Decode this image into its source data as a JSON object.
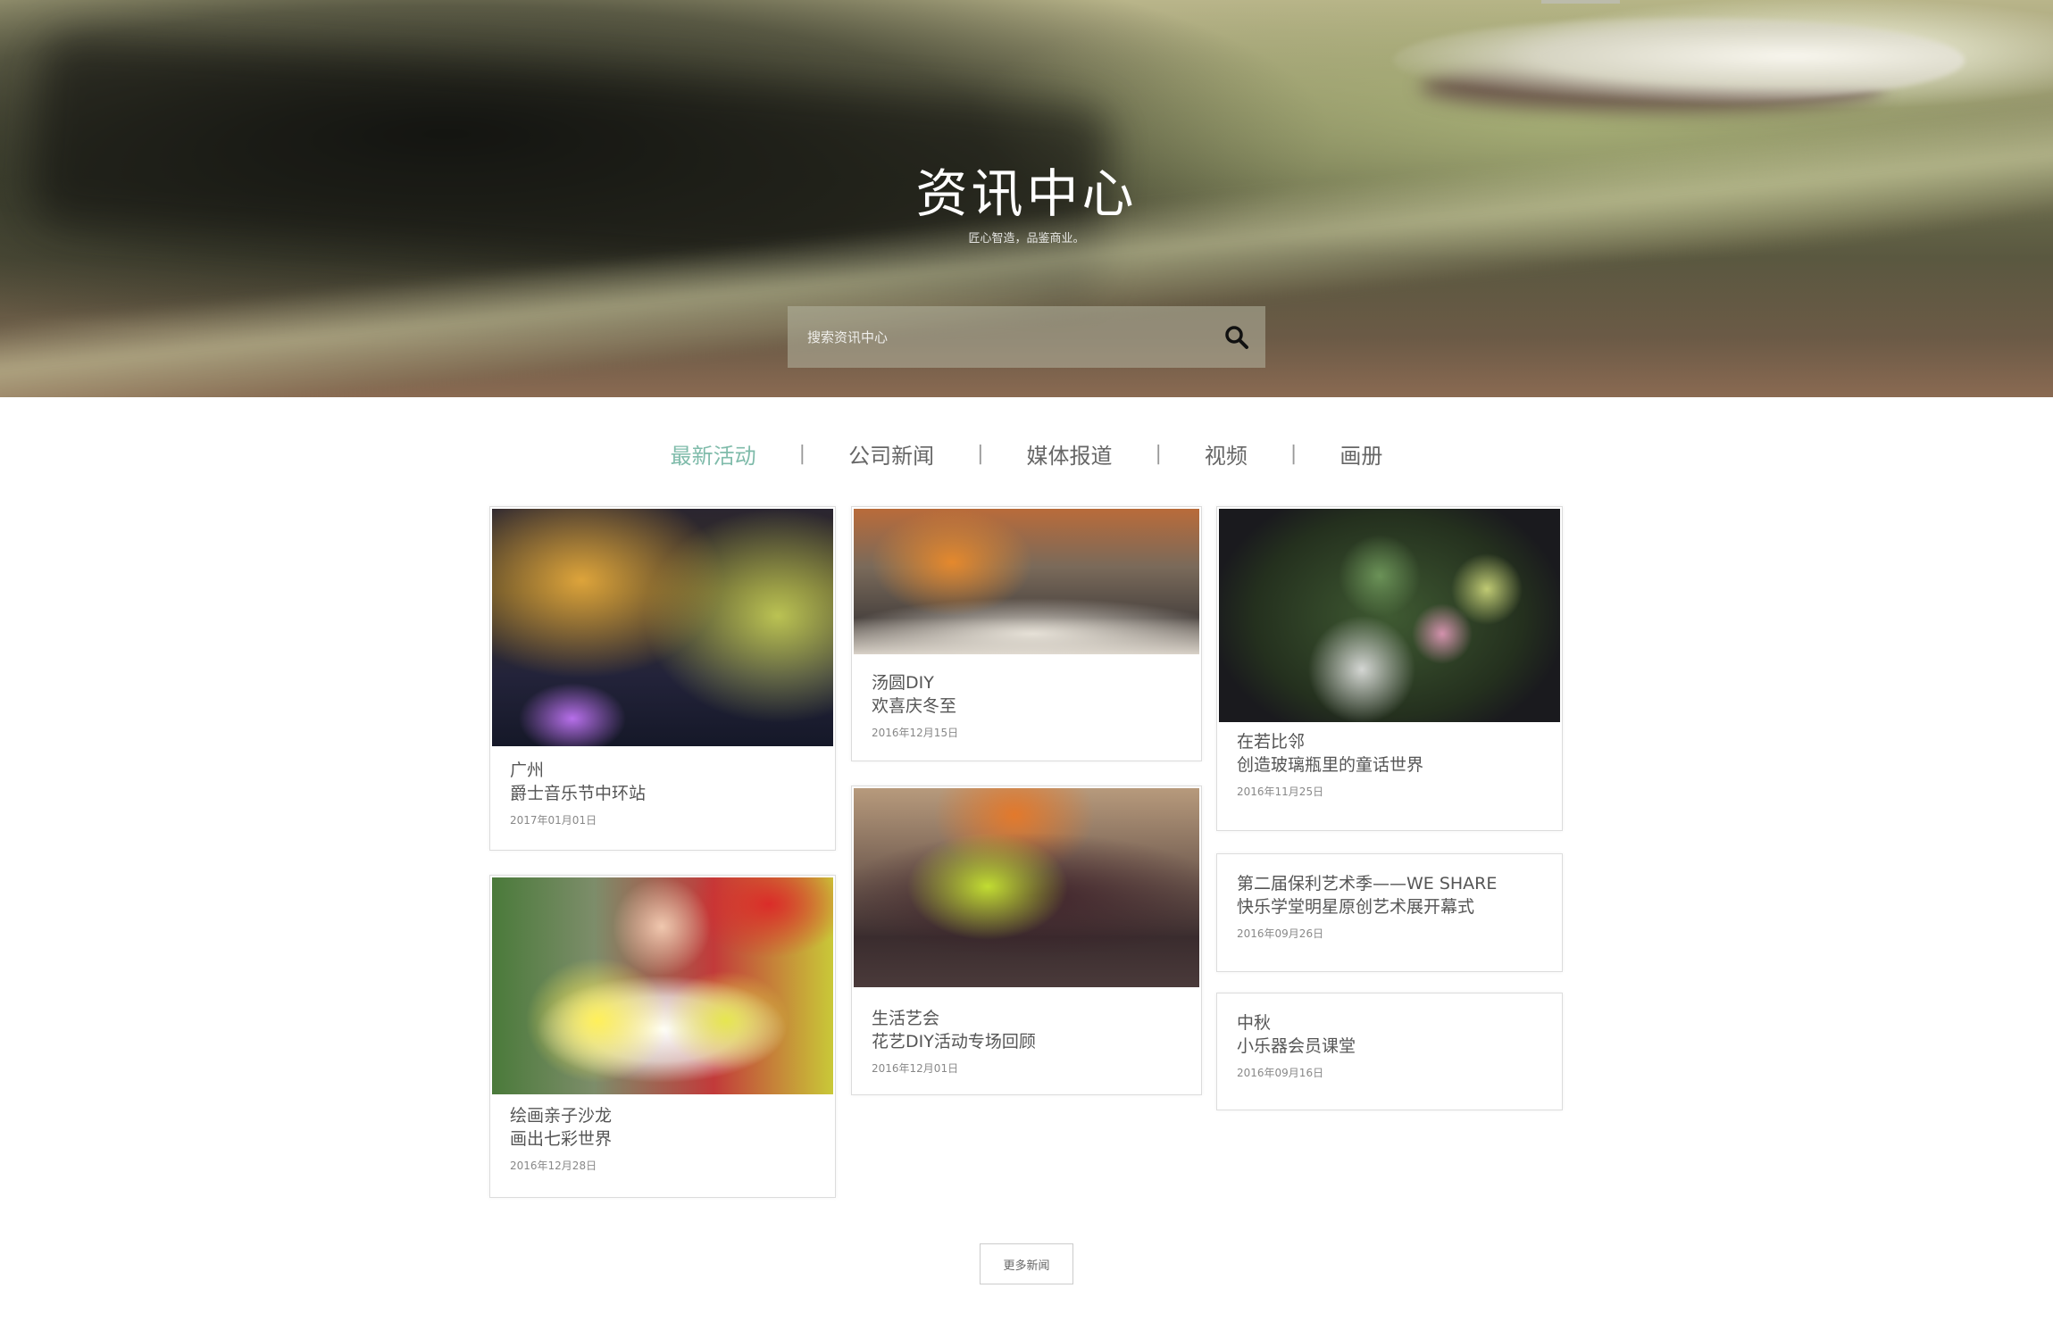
{
  "hero": {
    "title": "资讯中心",
    "subtitle": "匠心智造，品鉴商业。"
  },
  "search": {
    "placeholder": "搜索资讯中心",
    "button_icon": "search-icon"
  },
  "tabs": [
    {
      "label": "最新活动",
      "active": true
    },
    {
      "label": "公司新闻",
      "active": false
    },
    {
      "label": "媒体报道",
      "active": false
    },
    {
      "label": "视频",
      "active": false
    },
    {
      "label": "画册",
      "active": false
    }
  ],
  "tab_separator": "|",
  "colors": {
    "accent": "#7fbbaa",
    "text": "#555555",
    "muted": "#888888",
    "border": "#dcdcdc"
  },
  "cards": [
    {
      "line1": "广州",
      "line2": "爵士音乐节中环站",
      "date": "2017年01月01日",
      "image": "jazz-concert-photo"
    },
    {
      "line1": "汤圆DIY",
      "line2": "欢喜庆冬至",
      "date": "2016年12月15日",
      "image": "dinner-gathering-photo"
    },
    {
      "line1": "在若比邻",
      "line2": "创造玻璃瓶里的童话世界",
      "date": "2016年11月25日",
      "image": "succulent-terrarium-photo"
    },
    {
      "line1": "绘画亲子沙龙",
      "line2": "画出七彩世界",
      "date": "2016年12月28日",
      "image": "child-drawing-photo"
    },
    {
      "line1": "生活艺会",
      "line2": "花艺DIY活动专场回顾",
      "date": "2016年12月01日",
      "image": "flower-arrangement-group-photo"
    },
    {
      "line1": "第二届保利艺术季——WE SHARE",
      "line2": "快乐学堂明星原创艺术展开幕式",
      "date": "2016年09月26日"
    },
    {
      "line1": "中秋",
      "line2": "小乐器会员课堂",
      "date": "2016年09月16日"
    }
  ],
  "more_button": "更多新闻"
}
